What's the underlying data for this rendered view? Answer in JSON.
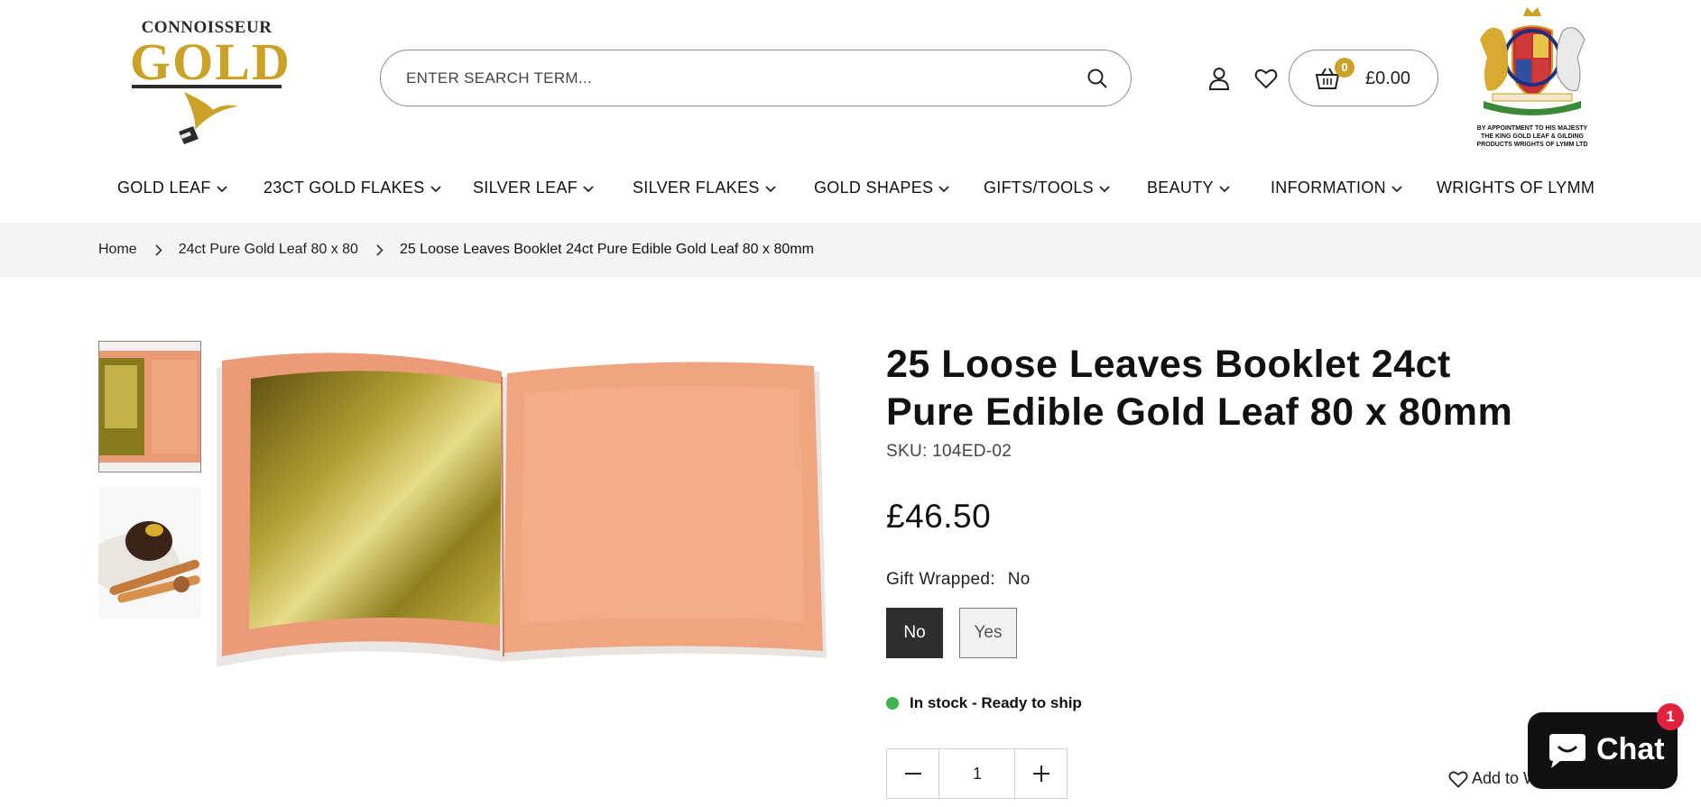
{
  "header": {
    "logo": {
      "top_text": "CONNOISSEUR",
      "main_text": "GOLD"
    },
    "search": {
      "placeholder": "ENTER SEARCH TERM..."
    },
    "cart": {
      "count": "0",
      "total": "£0.00"
    },
    "crest": {
      "caption": "BY APPOINTMENT TO HIS MAJESTY THE KING GOLD LEAF & GILDING PRODUCTS WRIGHTS OF LYMM LTD"
    }
  },
  "nav": {
    "items": [
      {
        "label": "GOLD LEAF"
      },
      {
        "label": "23CT GOLD FLAKES"
      },
      {
        "label": "SILVER LEAF"
      },
      {
        "label": "SILVER FLAKES"
      },
      {
        "label": "GOLD SHAPES"
      },
      {
        "label": "GIFTS/TOOLS"
      },
      {
        "label": "BEAUTY"
      },
      {
        "label": "INFORMATION"
      },
      {
        "label": "WRIGHTS OF LYMM"
      }
    ]
  },
  "breadcrumb": {
    "items": [
      {
        "label": "Home"
      },
      {
        "label": "24ct Pure Gold Leaf 80 x 80"
      },
      {
        "label": "25 Loose Leaves Booklet 24ct Pure Edible Gold Leaf 80 x 80mm"
      }
    ]
  },
  "product": {
    "title": "25 Loose Leaves Booklet 24ct Pure Edible Gold Leaf 80 x 80mm",
    "sku_label": "SKU:",
    "sku": "104ED-02",
    "price": "£46.50",
    "gift_label": "Gift Wrapped:",
    "gift_value": "No",
    "options": [
      {
        "label": "No",
        "selected": true
      },
      {
        "label": "Yes",
        "selected": false
      }
    ],
    "stock": "In stock - Ready to ship",
    "quantity": "1",
    "add_wishlist": "Add to W"
  },
  "chat": {
    "label": "Chat",
    "badge": "1"
  },
  "colors": {
    "accent_gold": "#c9a227",
    "stock_green": "#3cb54a",
    "badge_red": "#e0223f"
  }
}
